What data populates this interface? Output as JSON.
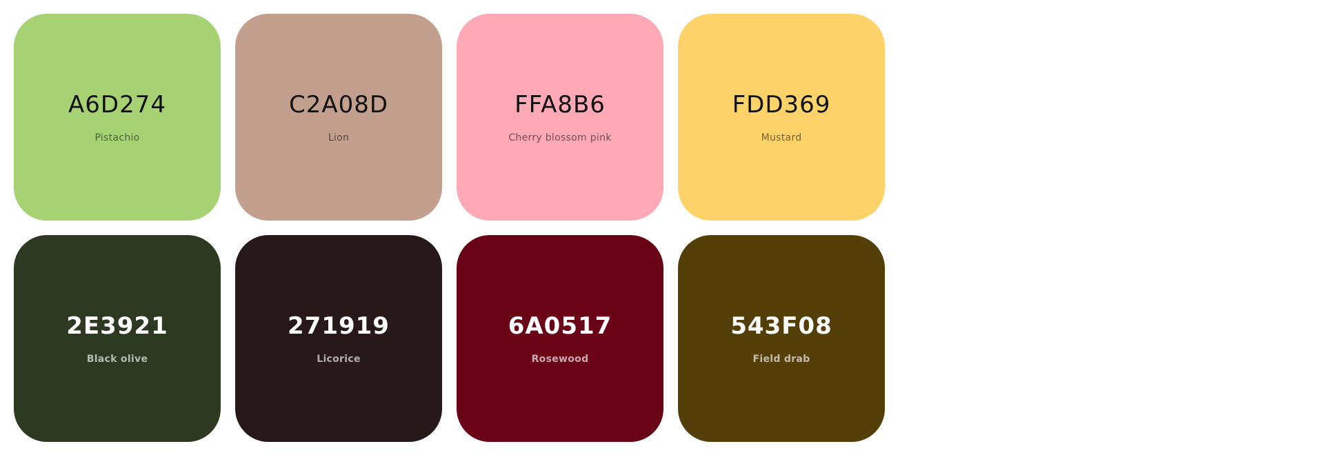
{
  "palette": [
    {
      "hex": "A6D274",
      "name": "Pistachio",
      "color": "#A6D274",
      "tone": "light"
    },
    {
      "hex": "C2A08D",
      "name": "Lion",
      "color": "#C2A08D",
      "tone": "light"
    },
    {
      "hex": "FFA8B6",
      "name": "Cherry blossom pink",
      "color": "#FFA8B6",
      "tone": "light"
    },
    {
      "hex": "FDD369",
      "name": "Mustard",
      "color": "#FDD369",
      "tone": "light"
    },
    {
      "hex": "2E3921",
      "name": "Black olive",
      "color": "#2E3921",
      "tone": "dark"
    },
    {
      "hex": "271919",
      "name": "Licorice",
      "color": "#271919",
      "tone": "dark"
    },
    {
      "hex": "6A0517",
      "name": "Rosewood",
      "color": "#6A0517",
      "tone": "dark"
    },
    {
      "hex": "543F08",
      "name": "Field drab",
      "color": "#543F08",
      "tone": "dark"
    }
  ]
}
